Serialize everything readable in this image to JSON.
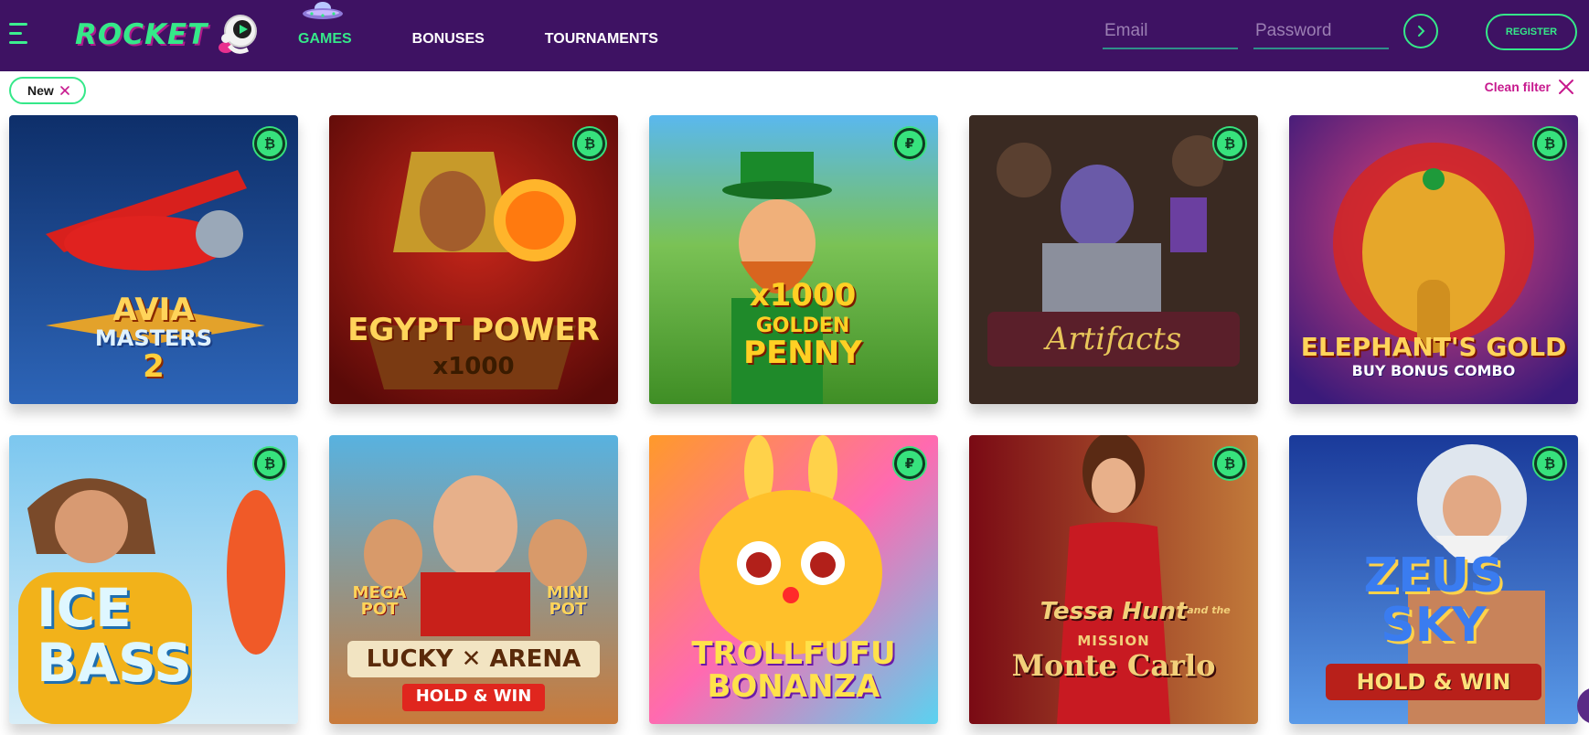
{
  "header": {
    "logo_text": "ROCKET",
    "nav": [
      {
        "label": "GAMES",
        "active": true
      },
      {
        "label": "BONUSES",
        "active": false
      },
      {
        "label": "TOURNAMENTS",
        "active": false
      }
    ],
    "email_placeholder": "Email",
    "password_placeholder": "Password",
    "register_label": "REGISTER"
  },
  "filters": {
    "active_chip": "New",
    "clean_label": "Clean filter"
  },
  "games": [
    {
      "title": "AVIA MASTERS 2",
      "line1": "AVIA",
      "line2": "MASTERS",
      "line3": "2",
      "coin": "₿"
    },
    {
      "title": "EGYPT POWER x1000",
      "line1": "EGYPT POWER",
      "line2": "x1000",
      "coin": "₿"
    },
    {
      "title": "x1000 GOLDEN PENNY",
      "line1": "x1000",
      "line2": "GOLDEN",
      "line3": "PENNY",
      "coin": "₽"
    },
    {
      "title": "Artifacts",
      "line1": "Artifacts",
      "coin": "₿"
    },
    {
      "title": "ELEPHANT'S GOLD BUY BONUS COMBO",
      "line1": "ELEPHANT'S GOLD",
      "line2": "BUY BONUS COMBO",
      "coin": "₿"
    },
    {
      "title": "ICE BASS",
      "line1": "ICE",
      "line2": "BASS",
      "coin": "₿"
    },
    {
      "title": "MEGA POT MINI POT LUCKY ARENA HOLD & WIN",
      "badge1": "MEGA POT",
      "badge2": "MINI POT",
      "line1": "LUCKY ✕ ARENA",
      "line2": "HOLD & WIN"
    },
    {
      "title": "TROLLFUFU BONANZA",
      "line1": "TROLLFUFU",
      "line2": "BONANZA",
      "coin": "₽"
    },
    {
      "title": "Tessa Hunt and the Mission Monte Carlo",
      "line1": "Tessa Hunt",
      "small": "and the",
      "line2": "MISSION",
      "line3": "Monte Carlo",
      "coin": "₿"
    },
    {
      "title": "ZEUS SKY HOLD & WIN",
      "line1": "ZEUS",
      "line2": "SKY",
      "line3": "HOLD & WIN",
      "coin": "₿"
    }
  ],
  "colors": {
    "header_bg": "#3e1263",
    "accent_green": "#35e889",
    "accent_pink": "#c7198e"
  }
}
